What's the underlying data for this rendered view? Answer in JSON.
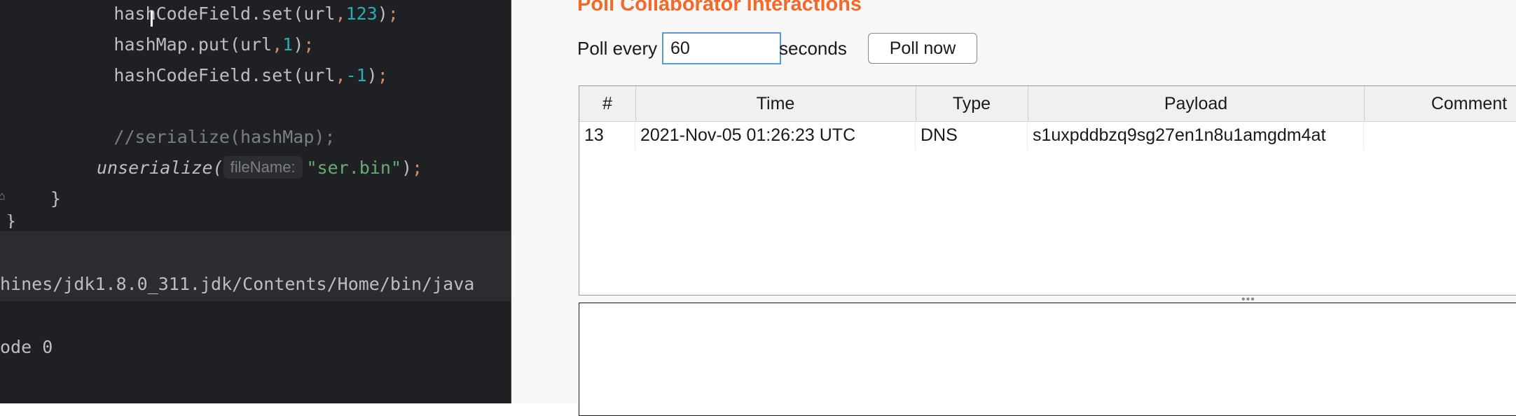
{
  "ide": {
    "code_lines": [
      {
        "indent": "    ",
        "parts": [
          {
            "t": "hashCodeField.set(url",
            "c": ""
          },
          {
            "t": ",",
            "c": "tok-punc"
          },
          {
            "t": "123",
            "c": "tok-num"
          },
          {
            "t": ")",
            "c": ""
          },
          {
            "t": ";",
            "c": "tok-punc"
          }
        ]
      },
      {
        "indent": "    ",
        "parts": [
          {
            "t": "hashMap.put(url",
            "c": ""
          },
          {
            "t": ",",
            "c": "tok-punc"
          },
          {
            "t": "1",
            "c": "tok-num"
          },
          {
            "t": ")",
            "c": ""
          },
          {
            "t": ";",
            "c": "tok-punc"
          }
        ]
      },
      {
        "indent": "    ",
        "parts": [
          {
            "t": "hashCodeField.set(url",
            "c": ""
          },
          {
            "t": ",",
            "c": "tok-punc"
          },
          {
            "t": "-1",
            "c": "tok-num"
          },
          {
            "t": ")",
            "c": ""
          },
          {
            "t": ";",
            "c": "tok-punc"
          }
        ]
      },
      {
        "indent": "",
        "parts": []
      },
      {
        "indent": "    ",
        "parts": [
          {
            "t": "//serialize(hashMap);",
            "c": "tok-comment"
          }
        ]
      }
    ],
    "unserialize_call": "unserialize(",
    "param_hint": "fileName:",
    "unserialize_arg": "\"ser.bin\"",
    "unserialize_close": ")",
    "semicolon": ";",
    "closing_brace": "}",
    "closing_brace_partial": "}",
    "console_path": "hines/jdk1.8.0_311.jdk/Contents/Home/bin/java",
    "exit_text": "ode 0"
  },
  "collaborator": {
    "title": "Poll Collaborator interactions",
    "poll_every_label": "Poll every",
    "poll_interval_value": "60",
    "seconds_label": "seconds",
    "poll_now_label": "Poll now",
    "columns": [
      "#",
      "Time",
      "Type",
      "Payload",
      "Comment"
    ],
    "rows": [
      {
        "num": "13",
        "time": "2021-Nov-05 01:26:23 UTC",
        "type": "DNS",
        "payload": "s1uxpddbzq9sg27en1n8u1amgdm4at",
        "comment": ""
      }
    ],
    "split_handle": "•••",
    "accent_color": "#f26a2a"
  }
}
